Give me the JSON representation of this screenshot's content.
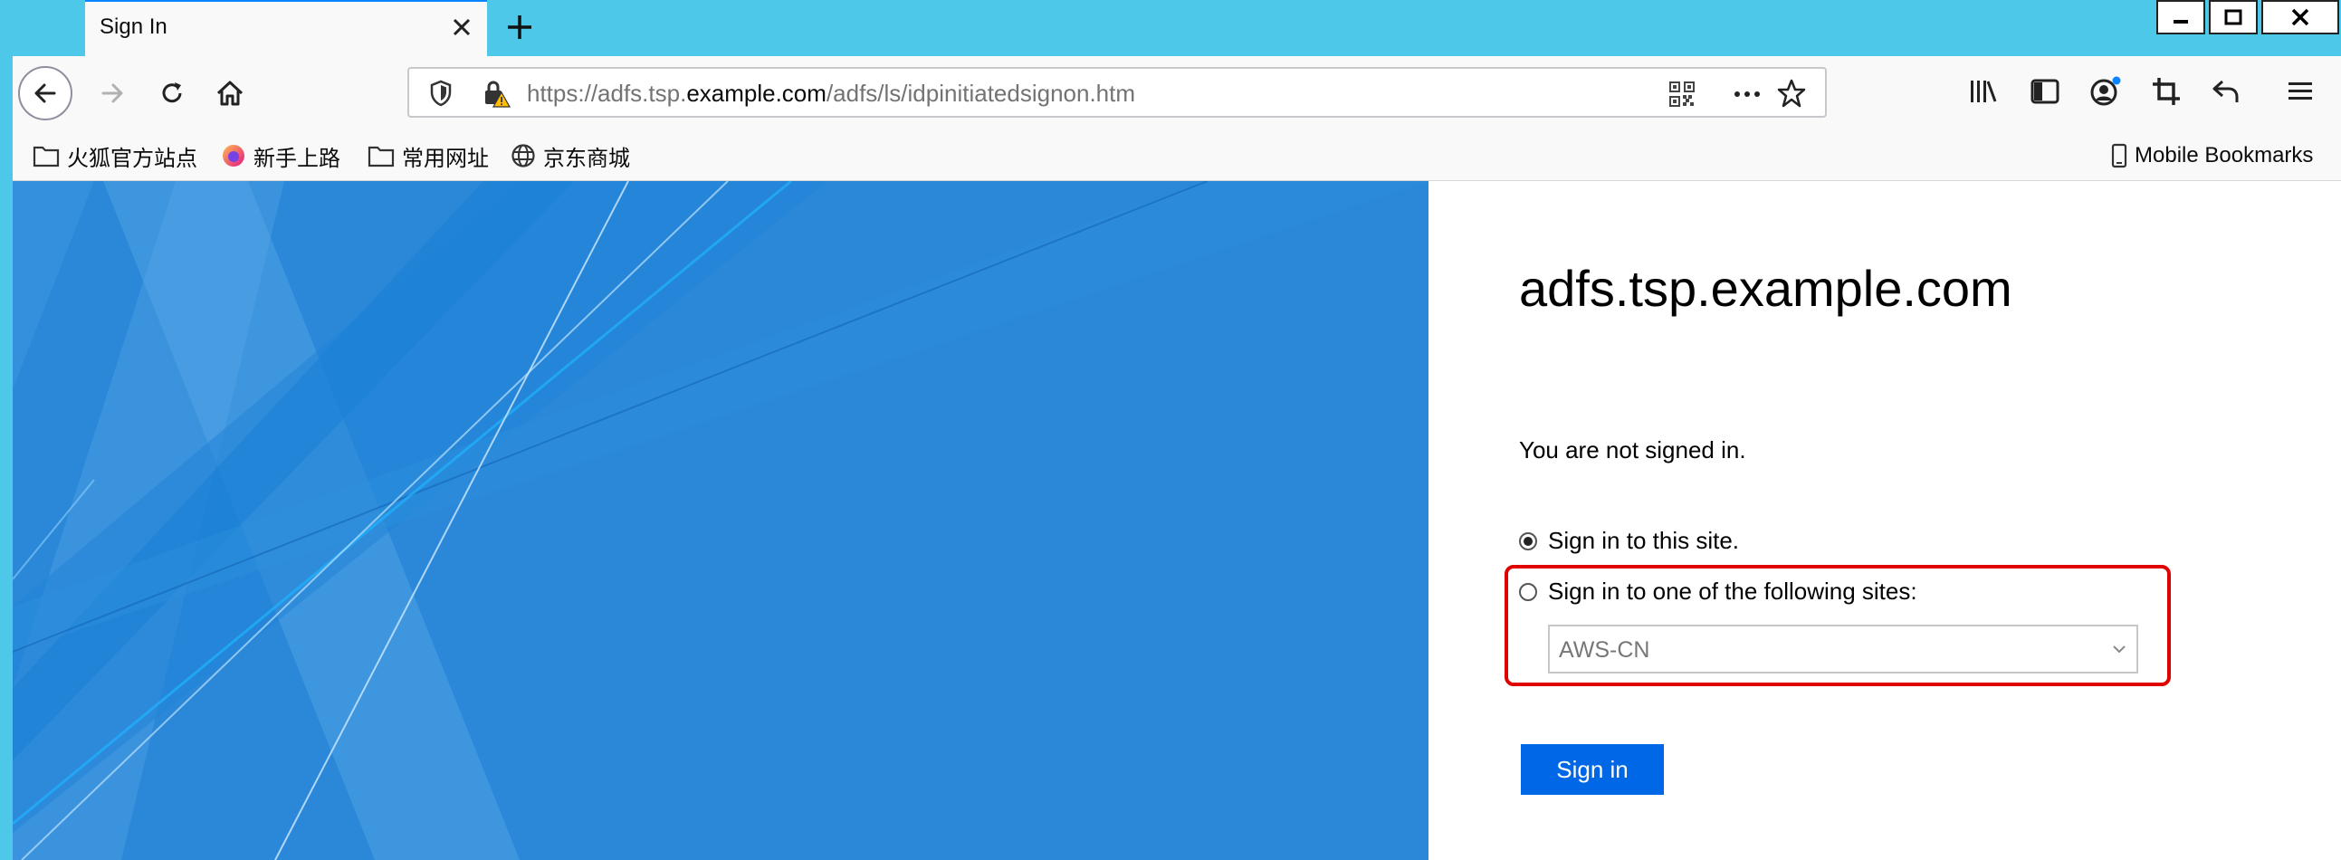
{
  "browser": {
    "tab": {
      "title": "Sign In"
    },
    "url": {
      "prefix": "https://adfs.tsp.",
      "domain": "example.com",
      "path": "/adfs/ls/idpinitiatedsignon.htm"
    },
    "bookmarks": [
      "火狐官方站点",
      "新手上路",
      "常用网址",
      "京东商城"
    ],
    "mobile_bookmarks": "Mobile Bookmarks"
  },
  "icons": {
    "tab_close": "close-icon",
    "new_tab": "plus-icon",
    "back": "arrow-left-icon",
    "forward": "arrow-right-icon",
    "reload": "reload-icon",
    "home": "home-icon",
    "tracking": "shield-icon",
    "security": "lock-warning-icon",
    "qr": "qr-code-icon",
    "page_actions": "more-icon",
    "bookmark": "star-icon",
    "library": "library-icon",
    "sidebar": "sidebar-icon",
    "account": "account-icon",
    "screenshot": "crop-icon",
    "undo": "undo-icon",
    "menu": "hamburger-icon",
    "minimize": "minimize-icon",
    "maximize": "maximize-icon",
    "close_window": "close-icon"
  },
  "colors": {
    "title_bar": "#4dc8e8",
    "illustration": "#2b88d8",
    "primary_button": "#0067e6",
    "highlight": "#e00000"
  },
  "page": {
    "title": "adfs.tsp.example.com",
    "status": "You are not signed in.",
    "options": [
      {
        "label": "Sign in to this site.",
        "selected": true
      },
      {
        "label": "Sign in to one of the following sites:",
        "selected": false
      }
    ],
    "site_select": {
      "value": "AWS-CN"
    },
    "signin_button": "Sign in"
  }
}
